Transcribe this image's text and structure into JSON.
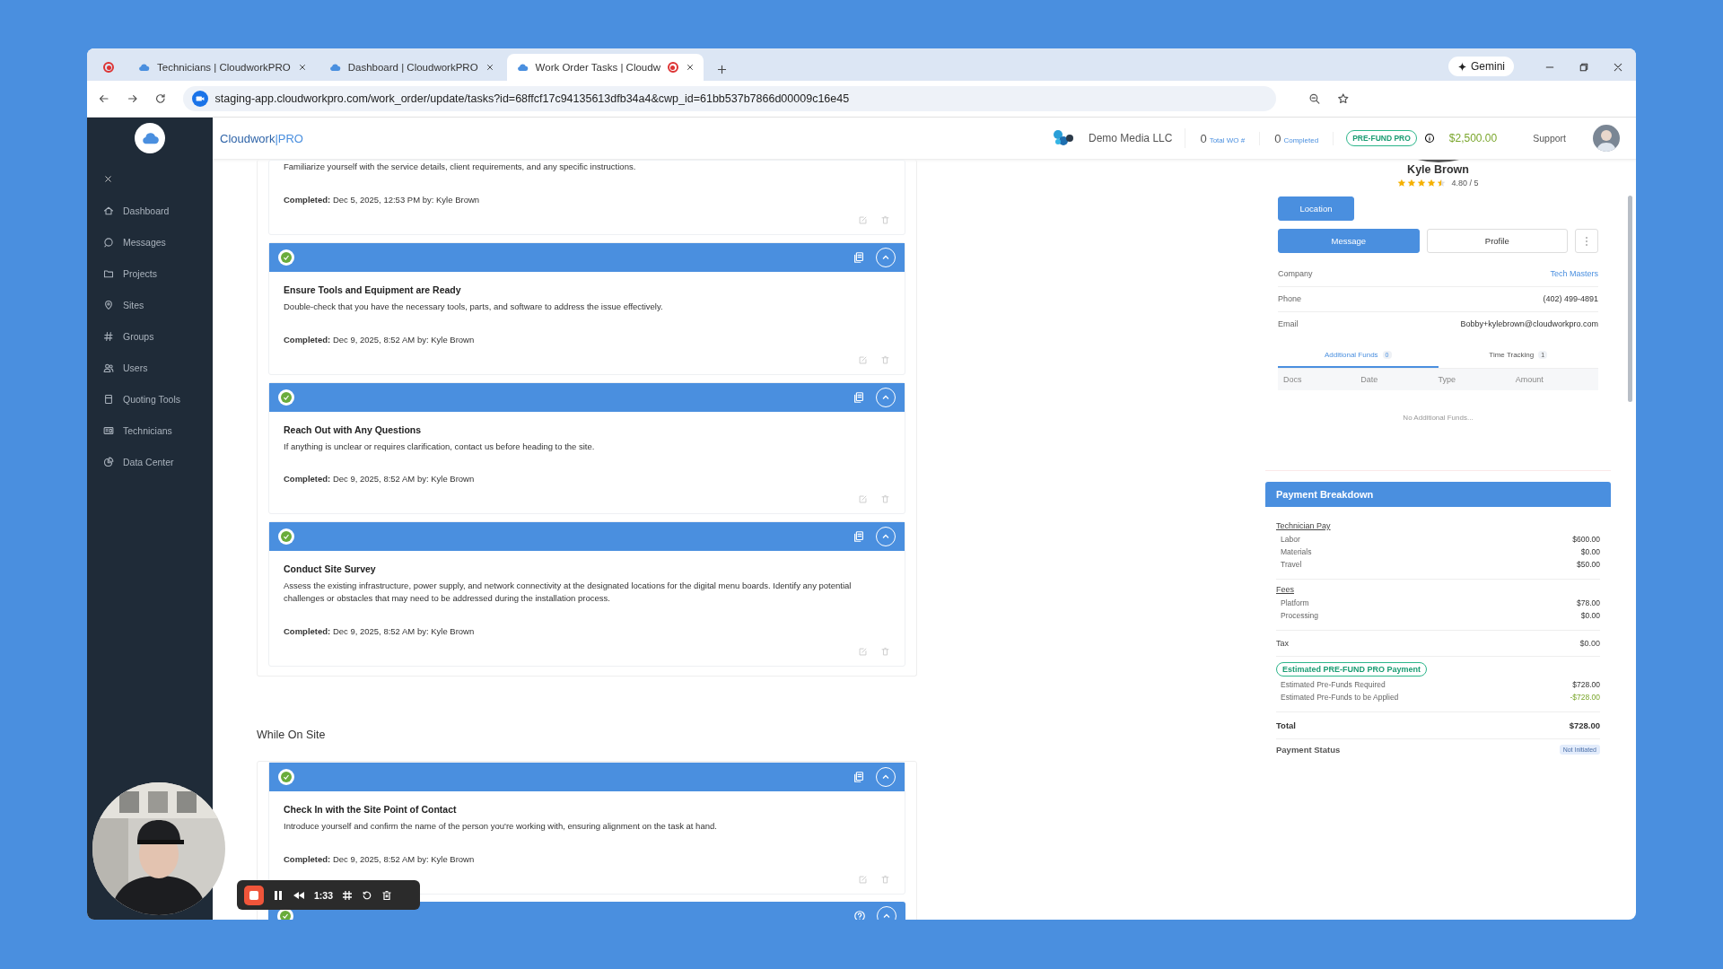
{
  "browser": {
    "tabs": [
      {
        "title": "Technicians | CloudworkPRO",
        "selected": false,
        "recording": false
      },
      {
        "title": "Dashboard | CloudworkPRO",
        "selected": false,
        "recording": false
      },
      {
        "title": "Work Order Tasks | Cloudw",
        "selected": true,
        "recording": true
      }
    ],
    "gemini": "Gemini",
    "url": "staging-app.cloudworkpro.com/work_order/update/tasks?id=68ffcf17c94135613dfb34a4&cwp_id=61bb537b7866d00009c16e45"
  },
  "header": {
    "brand": "Cloudwork",
    "brand_suffix": "|PRO",
    "company": "Demo Media LLC",
    "stats": [
      {
        "count": "0",
        "label": "Total WO #"
      },
      {
        "count": "0",
        "label": "Completed"
      }
    ],
    "plan_badge": "PRE-FUND PRO",
    "balance": "$2,500.00",
    "support": "Support"
  },
  "sidebar": {
    "items": [
      {
        "label": "Dashboard",
        "kind": "home"
      },
      {
        "label": "Messages",
        "kind": "chat"
      },
      {
        "label": "Projects",
        "kind": "folder"
      },
      {
        "label": "Sites",
        "kind": "pin"
      },
      {
        "label": "Groups",
        "kind": "hash"
      },
      {
        "label": "Users",
        "kind": "users"
      },
      {
        "label": "Quoting Tools",
        "kind": "calculator"
      },
      {
        "label": "Technicians",
        "kind": "card"
      },
      {
        "label": "Data Center",
        "kind": "chart"
      }
    ]
  },
  "sections": [
    {
      "tasks": [
        {
          "kind": "partial",
          "description": "Familiarize yourself with the service details, client requirements, and any specific instructions.",
          "completed_label": "Completed:",
          "completed_text": "Dec 5, 2025, 12:53 PM by: Kyle Brown"
        },
        {
          "kind": "full",
          "done": true,
          "expanded": true,
          "title": "Ensure Tools and Equipment are Ready",
          "description": "Double-check that you have the necessary tools, parts, and software to address the issue effectively.",
          "completed_label": "Completed:",
          "completed_text": "Dec 9, 2025, 8:52 AM by: Kyle Brown"
        },
        {
          "kind": "full",
          "done": true,
          "expanded": true,
          "title": "Reach Out with Any Questions",
          "description": "If anything is unclear or requires clarification, contact us before heading to the site.",
          "completed_label": "Completed:",
          "completed_text": "Dec 9, 2025, 8:52 AM by: Kyle Brown"
        },
        {
          "kind": "full",
          "done": true,
          "expanded": true,
          "title": "Conduct Site Survey",
          "description": "Assess the existing infrastructure, power supply, and network connectivity at the designated locations for the digital menu boards. Identify any potential challenges or obstacles that may need to be addressed during the installation process.",
          "completed_label": "Completed:",
          "completed_text": "Dec 9, 2025, 8:52 AM by: Kyle Brown"
        }
      ]
    },
    {
      "title": "While On Site",
      "tasks": [
        {
          "kind": "full",
          "done": true,
          "expanded": true,
          "title": "Check In with the Site Point of Contact",
          "description": "Introduce yourself and confirm the name of the person you're working with, ensuring alignment on the task at hand.",
          "completed_label": "Completed:",
          "completed_text": "Dec 9, 2025, 8:52 AM by: Kyle Brown"
        },
        {
          "kind": "header",
          "done": true,
          "expanded": true
        }
      ]
    }
  ],
  "technician": {
    "name": "Kyle Brown",
    "stars": 4.5,
    "rating": "4.80 / 5",
    "location_button": "Location",
    "message_button": "Message",
    "profile_button": "Profile",
    "info": [
      {
        "label": "Company",
        "value": "Tech Masters",
        "kind": "link"
      },
      {
        "label": "Phone",
        "value": "(402) 499-4891",
        "kind": "text"
      },
      {
        "label": "Email",
        "value": "Bobby+kylebrown@cloudworkpro.com",
        "kind": "text"
      }
    ],
    "tabs": [
      {
        "label": "Additional Funds",
        "count": "0",
        "selected": true
      },
      {
        "label": "Time Tracking",
        "count": "1",
        "selected": false
      }
    ],
    "columns": [
      "Docs",
      "Date",
      "Type",
      "Amount"
    ],
    "empty_text": "No Additional Funds..."
  },
  "payment": {
    "title": "Payment Breakdown",
    "blocks": [
      {
        "kind": "group",
        "title": "Technician Pay",
        "rows": [
          {
            "label": "Labor",
            "value": "$600.00"
          },
          {
            "label": "Materials",
            "value": "$0.00"
          },
          {
            "label": "Travel",
            "value": "$50.00"
          }
        ]
      },
      {
        "kind": "group",
        "title": "Fees",
        "rows": [
          {
            "label": "Platform",
            "value": "$78.00"
          },
          {
            "label": "Processing",
            "value": "$0.00"
          }
        ]
      },
      {
        "kind": "line",
        "label": "Tax",
        "value": "$0.00"
      },
      {
        "kind": "estimate",
        "title": "Estimated PRE-FUND PRO Payment",
        "rows": [
          {
            "label": "Estimated Pre-Funds Required",
            "value": "$728.00",
            "credit": false
          },
          {
            "label": "Estimated Pre-Funds to be Applied",
            "value": "-$728.00",
            "credit": true
          }
        ]
      },
      {
        "kind": "total",
        "label": "Total",
        "value": "$728.00"
      },
      {
        "kind": "status",
        "label": "Payment Status",
        "value": "Not Initiated"
      }
    ]
  },
  "recorder": {
    "time": "1:33"
  }
}
